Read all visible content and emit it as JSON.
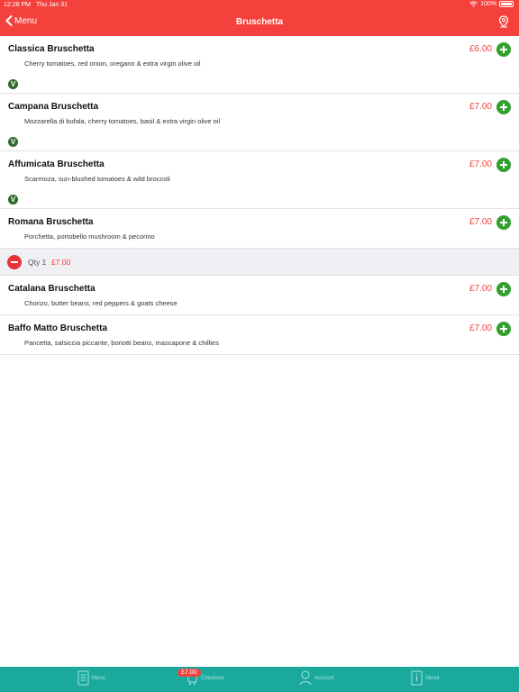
{
  "status_bar": {
    "time": "12:28 PM",
    "date": "Thu Jan 31",
    "battery": "100%"
  },
  "nav": {
    "back_label": "Menu",
    "title": "Bruschetta"
  },
  "items": [
    {
      "name": "Classica Bruschetta",
      "description": "Cherry tomatoes, red onion, oregano & extra virgin olive oil",
      "price": "£6.00",
      "veg": "V"
    },
    {
      "name": "Campana Bruschetta",
      "description": "Mozzarella di bufala, cherry tomatoes, basil & extra virgin olive oil",
      "price": "£7.00",
      "veg": "V"
    },
    {
      "name": "Affumicata Bruschetta",
      "description": "Scarmoza, sun-blushed tomatoes & wild broccoli",
      "price": "£7.00",
      "veg": "V"
    },
    {
      "name": "Romana Bruschetta",
      "description": "Porchetta, portobello mushroom & pecorino",
      "price": "£7.00"
    },
    {
      "name": "Catalana Bruschetta",
      "description": "Chorizo, butter beans, red peppers & goats cheese",
      "price": "£7.00"
    },
    {
      "name": "Baffo Matto Bruschetta",
      "description": "Pancetta, salsiccia piccante, boriotti beans, mascapone & chillies",
      "price": "£7.00"
    }
  ],
  "cart_line": {
    "qty_label": "Qty 1",
    "price": "£7.00"
  },
  "tabs": [
    {
      "label": "Menu",
      "icon": "menu-icon"
    },
    {
      "label": "Checkout",
      "icon": "cart-icon",
      "badge": "£7.00"
    },
    {
      "label": "Account",
      "icon": "account-icon"
    },
    {
      "label": "About",
      "icon": "info-icon"
    }
  ],
  "colors": {
    "brand": "#f5413b",
    "add": "#32a02c",
    "veg": "#2d6b2a",
    "tabbar": "#1ba99e"
  }
}
